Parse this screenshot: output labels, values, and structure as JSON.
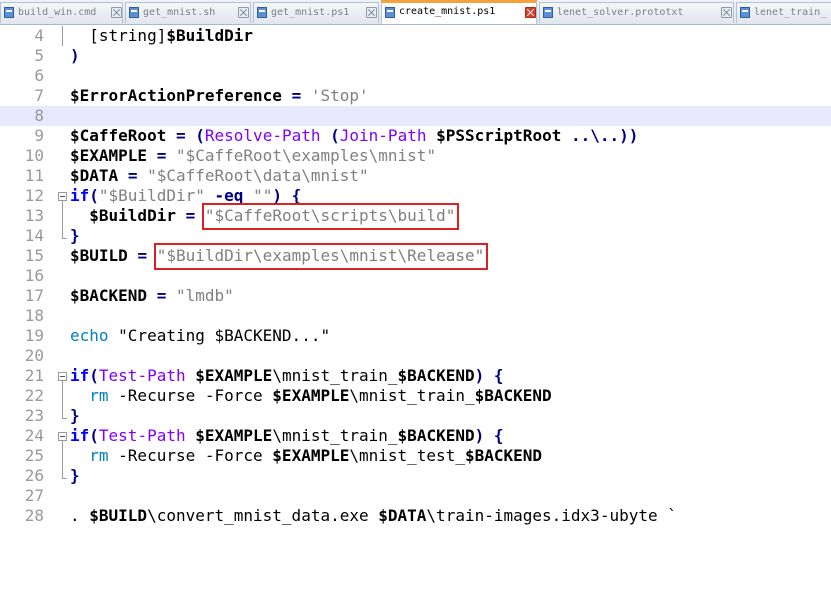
{
  "tabs": [
    {
      "label": "build_win.cmd",
      "active": false
    },
    {
      "label": "get_mnist.sh",
      "active": false
    },
    {
      "label": "get_mnist.ps1",
      "active": false
    },
    {
      "label": "create_mnist.ps1",
      "active": true
    },
    {
      "label": "lenet_solver.prototxt",
      "active": false
    },
    {
      "label": "lenet_train_",
      "active": false
    }
  ],
  "editor": {
    "highlighted_line": 8,
    "lines": [
      {
        "num": 4,
        "fold": "guide",
        "tokens": [
          {
            "t": "  [string]",
            "c": "p"
          },
          {
            "t": "$BuildDir",
            "c": "v"
          }
        ]
      },
      {
        "num": 5,
        "fold": "",
        "tokens": [
          {
            "t": ")",
            "c": "o"
          }
        ]
      },
      {
        "num": 6,
        "fold": "",
        "tokens": []
      },
      {
        "num": 7,
        "fold": "",
        "tokens": [
          {
            "t": "$ErrorActionPreference",
            "c": "v"
          },
          {
            "t": " ",
            "c": "p"
          },
          {
            "t": "=",
            "c": "o"
          },
          {
            "t": " ",
            "c": "p"
          },
          {
            "t": "'Stop'",
            "c": "s"
          }
        ]
      },
      {
        "num": 8,
        "fold": "",
        "tokens": []
      },
      {
        "num": 9,
        "fold": "",
        "tokens": [
          {
            "t": "$CaffeRoot",
            "c": "v"
          },
          {
            "t": " ",
            "c": "p"
          },
          {
            "t": "=",
            "c": "o"
          },
          {
            "t": " ",
            "c": "p"
          },
          {
            "t": "(",
            "c": "o"
          },
          {
            "t": "Resolve-Path",
            "c": "c"
          },
          {
            "t": " ",
            "c": "p"
          },
          {
            "t": "(",
            "c": "o"
          },
          {
            "t": "Join-Path",
            "c": "c"
          },
          {
            "t": " ",
            "c": "p"
          },
          {
            "t": "$PSScriptRoot",
            "c": "v"
          },
          {
            "t": " ",
            "c": "p"
          },
          {
            "t": "..\\..))",
            "c": "o"
          }
        ]
      },
      {
        "num": 10,
        "fold": "",
        "tokens": [
          {
            "t": "$EXAMPLE",
            "c": "v"
          },
          {
            "t": " ",
            "c": "p"
          },
          {
            "t": "=",
            "c": "o"
          },
          {
            "t": " ",
            "c": "p"
          },
          {
            "t": "\"$CaffeRoot\\examples\\mnist\"",
            "c": "s"
          }
        ]
      },
      {
        "num": 11,
        "fold": "",
        "tokens": [
          {
            "t": "$DATA",
            "c": "v"
          },
          {
            "t": " ",
            "c": "p"
          },
          {
            "t": "=",
            "c": "o"
          },
          {
            "t": " ",
            "c": "p"
          },
          {
            "t": "\"$CaffeRoot\\data\\mnist\"",
            "c": "s"
          }
        ]
      },
      {
        "num": 12,
        "fold": "open",
        "tokens": [
          {
            "t": "if",
            "c": "k"
          },
          {
            "t": "(",
            "c": "o"
          },
          {
            "t": "\"$BuildDir\"",
            "c": "s"
          },
          {
            "t": " ",
            "c": "p"
          },
          {
            "t": "-eq",
            "c": "o"
          },
          {
            "t": " ",
            "c": "p"
          },
          {
            "t": "\"\"",
            "c": "s"
          },
          {
            "t": ")",
            "c": "o"
          },
          {
            "t": " ",
            "c": "p"
          },
          {
            "t": "{",
            "c": "o"
          }
        ]
      },
      {
        "num": 13,
        "fold": "guide",
        "tokens": [
          {
            "t": "  ",
            "c": "p"
          },
          {
            "t": "$BuildDir",
            "c": "v"
          },
          {
            "t": " ",
            "c": "p"
          },
          {
            "t": "=",
            "c": "o"
          },
          {
            "t": " ",
            "c": "p"
          },
          {
            "t": "\"$CaffeRoot\\scripts\\build\"",
            "c": "s"
          }
        ]
      },
      {
        "num": 14,
        "fold": "end",
        "tokens": [
          {
            "t": "}",
            "c": "o"
          }
        ]
      },
      {
        "num": 15,
        "fold": "",
        "tokens": [
          {
            "t": "$BUILD",
            "c": "v"
          },
          {
            "t": " ",
            "c": "p"
          },
          {
            "t": "=",
            "c": "o"
          },
          {
            "t": " ",
            "c": "p"
          },
          {
            "t": "\"$BuildDir\\examples\\mnist\\Release\"",
            "c": "s"
          }
        ]
      },
      {
        "num": 16,
        "fold": "",
        "tokens": []
      },
      {
        "num": 17,
        "fold": "",
        "tokens": [
          {
            "t": "$BACKEND",
            "c": "v"
          },
          {
            "t": " ",
            "c": "p"
          },
          {
            "t": "=",
            "c": "o"
          },
          {
            "t": " ",
            "c": "p"
          },
          {
            "t": "\"lmdb\"",
            "c": "s"
          }
        ]
      },
      {
        "num": 18,
        "fold": "",
        "tokens": []
      },
      {
        "num": 19,
        "fold": "",
        "tokens": [
          {
            "t": "echo",
            "c": "a"
          },
          {
            "t": " \"Creating $BACKEND...\"",
            "c": "p"
          }
        ]
      },
      {
        "num": 20,
        "fold": "",
        "tokens": []
      },
      {
        "num": 21,
        "fold": "open",
        "tokens": [
          {
            "t": "if",
            "c": "k"
          },
          {
            "t": "(",
            "c": "o"
          },
          {
            "t": "Test-Path",
            "c": "c"
          },
          {
            "t": " ",
            "c": "p"
          },
          {
            "t": "$EXAMPLE",
            "c": "v"
          },
          {
            "t": "\\mnist_train_",
            "c": "p"
          },
          {
            "t": "$BACKEND",
            "c": "v"
          },
          {
            "t": ")",
            "c": "o"
          },
          {
            "t": " ",
            "c": "p"
          },
          {
            "t": "{",
            "c": "o"
          }
        ]
      },
      {
        "num": 22,
        "fold": "guide",
        "tokens": [
          {
            "t": "  ",
            "c": "p"
          },
          {
            "t": "rm",
            "c": "a"
          },
          {
            "t": " -Recurse -Force ",
            "c": "p"
          },
          {
            "t": "$EXAMPLE",
            "c": "v"
          },
          {
            "t": "\\mnist_train_",
            "c": "p"
          },
          {
            "t": "$BACKEND",
            "c": "v"
          }
        ]
      },
      {
        "num": 23,
        "fold": "end",
        "tokens": [
          {
            "t": "}",
            "c": "o"
          }
        ]
      },
      {
        "num": 24,
        "fold": "open",
        "tokens": [
          {
            "t": "if",
            "c": "k"
          },
          {
            "t": "(",
            "c": "o"
          },
          {
            "t": "Test-Path",
            "c": "c"
          },
          {
            "t": " ",
            "c": "p"
          },
          {
            "t": "$EXAMPLE",
            "c": "v"
          },
          {
            "t": "\\mnist_train_",
            "c": "p"
          },
          {
            "t": "$BACKEND",
            "c": "v"
          },
          {
            "t": ")",
            "c": "o"
          },
          {
            "t": " ",
            "c": "p"
          },
          {
            "t": "{",
            "c": "o"
          }
        ]
      },
      {
        "num": 25,
        "fold": "guide",
        "tokens": [
          {
            "t": "  ",
            "c": "p"
          },
          {
            "t": "rm",
            "c": "a"
          },
          {
            "t": " -Recurse -Force ",
            "c": "p"
          },
          {
            "t": "$EXAMPLE",
            "c": "v"
          },
          {
            "t": "\\mnist_test_",
            "c": "p"
          },
          {
            "t": "$BACKEND",
            "c": "v"
          }
        ]
      },
      {
        "num": 26,
        "fold": "end",
        "tokens": [
          {
            "t": "}",
            "c": "o"
          }
        ]
      },
      {
        "num": 27,
        "fold": "",
        "tokens": []
      },
      {
        "num": 28,
        "fold": "",
        "tokens": [
          {
            "t": ". ",
            "c": "p"
          },
          {
            "t": "$BUILD",
            "c": "v"
          },
          {
            "t": "\\convert_mnist_data.exe ",
            "c": "p"
          },
          {
            "t": "$DATA",
            "c": "v"
          },
          {
            "t": "\\train-images.idx3-ubyte `",
            "c": "p"
          }
        ]
      }
    ]
  },
  "annotations": [
    {
      "line": 13,
      "note": "red-box-buildir-path"
    },
    {
      "line": 15,
      "note": "red-box-build-path"
    }
  ]
}
